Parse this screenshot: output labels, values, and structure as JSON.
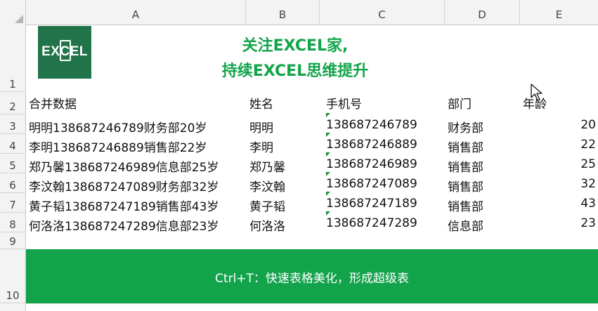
{
  "columns": [
    "A",
    "B",
    "C",
    "D",
    "E"
  ],
  "rows": [
    "1",
    "2",
    "3",
    "4",
    "5",
    "6",
    "7",
    "8",
    "9",
    "10"
  ],
  "logo_text": "EXCEL",
  "title": {
    "line1": "关注EXCEL家,",
    "line2": "持续EXCEL思维提升"
  },
  "headers": {
    "merged": "合并数据",
    "name": "姓名",
    "phone": "手机号",
    "dept": "部门",
    "age": "年龄"
  },
  "data_rows": [
    {
      "merged": "明明138687246789财务部20岁",
      "name": "明明",
      "phone": "138687246789",
      "dept": "财务部",
      "age": "20"
    },
    {
      "merged": "李明138687246889销售部22岁",
      "name": "李明",
      "phone": "138687246889",
      "dept": "销售部",
      "age": "22"
    },
    {
      "merged": "郑乃馨138687246989信息部25岁",
      "name": "郑乃馨",
      "phone": "138687246989",
      "dept": "销售部",
      "age": "25"
    },
    {
      "merged": "李汶翰138687247089财务部32岁",
      "name": "李汶翰",
      "phone": "138687247089",
      "dept": "销售部",
      "age": "32"
    },
    {
      "merged": "黄子韬138687247189销售部43岁",
      "name": "黄子韬",
      "phone": "138687247189",
      "dept": "销售部",
      "age": "43"
    },
    {
      "merged": "何洛洛138687247289信息部23岁",
      "name": "何洛洛",
      "phone": "138687247289",
      "dept": "信息部",
      "age": "23"
    }
  ],
  "banner": "Ctrl+T：快速表格美化，形成超级表",
  "colors": {
    "accent": "#13a44b",
    "logo_bg": "#21744a"
  }
}
